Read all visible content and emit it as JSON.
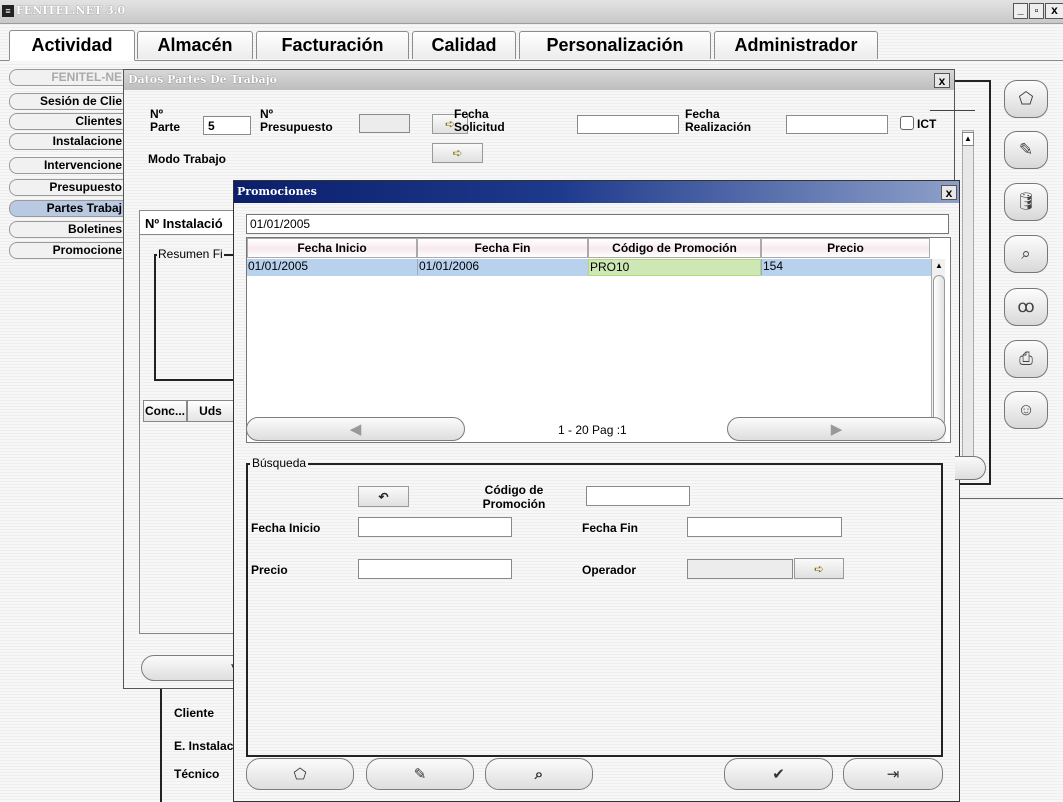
{
  "window": {
    "title": "FENITEL.NET 3.0",
    "controls": {
      "minimize": "_",
      "maximize": "▫",
      "close": "x"
    }
  },
  "tabs": [
    "Actividad",
    "Almacén",
    "Facturación",
    "Calidad",
    "Personalización",
    "Administrador"
  ],
  "nav": {
    "header": "FENITEL-NE",
    "items": [
      "Sesión de Clie",
      "Clientes",
      "Instalacione",
      "Intervencione",
      "Presupuesto",
      "Partes Trabaj",
      "Boletines",
      "Promocione"
    ],
    "active": "Partes Trabaj"
  },
  "bg_form": {
    "labels": {
      "cliente": "Cliente",
      "e_instalac": "E. Instalac",
      "tecnico": "Técnico"
    }
  },
  "datos_partes": {
    "title": "Datos Partes De Trabajo",
    "close": "x",
    "n_parte_label": "Nº\nParte",
    "n_parte_value": "5",
    "n_presupuesto_label": "Nº\nPresupuesto",
    "n_presupuesto_value": "",
    "fecha_solicitud_label": "Fecha\nSolicitud",
    "fecha_solicitud_value": "",
    "fecha_realizacion_label": "Fecha\nRealización",
    "fecha_realizacion_value": "",
    "ict_label": "ICT",
    "modo_trabajo_label": "Modo Trabajo",
    "subtab_label": "Nº Instalació",
    "resumen_label": "Resumen Fi",
    "table_headers": [
      "Conc...",
      "Uds"
    ],
    "bottom_button": "Va"
  },
  "promociones": {
    "title": "Promociones",
    "close": "x",
    "top_field_value": "01/01/2005",
    "table": {
      "headers": [
        "Fecha Inicio",
        "Fecha Fin",
        "Código de Promoción",
        "Precio"
      ],
      "rows": [
        [
          "01/01/2005",
          "01/01/2006",
          "PRO10",
          "154"
        ]
      ]
    },
    "pager": {
      "prev": "◀",
      "next": "▶",
      "text": "1 - 20 Pag :1"
    },
    "busqueda": {
      "title": "Búsqueda",
      "codigo_label": "Código de\nPromoción",
      "codigo_value": "",
      "fecha_inicio_label": "Fecha Inicio",
      "fecha_inicio_value": "",
      "fecha_fin_label": "Fecha Fin",
      "fecha_fin_value": "",
      "precio_label": "Precio",
      "precio_value": "",
      "operador_label": "Operador",
      "operador_value": ""
    },
    "buttons": {
      "new": "⬠",
      "edit": "✎",
      "search": "⌕",
      "accept": "✔",
      "exit": "⇥"
    }
  },
  "side_toolbar": [
    "new-icon",
    "edit-icon",
    "delete-icon",
    "view-icon",
    "binoculars-icon",
    "print-icon",
    "users-icon"
  ],
  "colors": {
    "title_bar": "#ffffff",
    "dialog_title": "#1a2f7c",
    "selected_row": "#b8d2ee",
    "highlight_cell": "#b9ec7c"
  }
}
